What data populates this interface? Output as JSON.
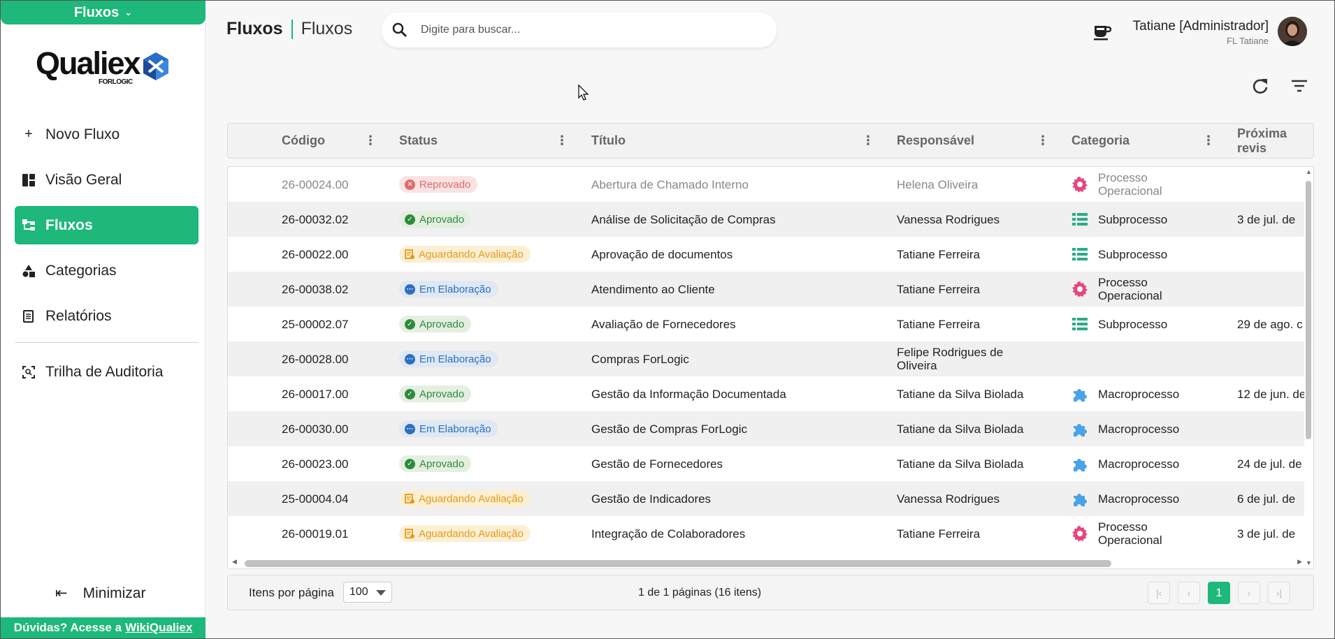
{
  "app_switcher": {
    "label": "Fluxos"
  },
  "logo": {
    "text": "Qualiex",
    "sub": "FORLOGIC"
  },
  "sidebar": {
    "items": [
      {
        "label": "Novo Fluxo",
        "icon": "plus-icon"
      },
      {
        "label": "Visão Geral",
        "icon": "dashboard-icon"
      },
      {
        "label": "Fluxos",
        "icon": "flow-icon",
        "active": true
      },
      {
        "label": "Categorias",
        "icon": "shapes-icon"
      },
      {
        "label": "Relatórios",
        "icon": "report-icon"
      },
      {
        "label": "Trilha de Auditoria",
        "icon": "audit-icon"
      }
    ],
    "minimize_label": "Minimizar",
    "help_text": "Dúvidas? Acesse a",
    "help_link": "WikiQualiex"
  },
  "header": {
    "title_main": "Fluxos",
    "title_sub": "Fluxos",
    "search_placeholder": "Digite para buscar...",
    "user_name": "Tatiane [Administrador]",
    "user_company": "FL Tatiane"
  },
  "table": {
    "columns": [
      "Código",
      "Status",
      "Título",
      "Responsável",
      "Categoria",
      "Próxima revis"
    ],
    "rows": [
      {
        "code": "26-00024.00",
        "status": "Reprovado",
        "status_type": "red",
        "title": "Abertura de Chamado Interno",
        "owner": "Helena Oliveira",
        "category": "Processo Operacional",
        "category_icon": "gear",
        "next": "",
        "dim": true
      },
      {
        "code": "26-00032.02",
        "status": "Aprovado",
        "status_type": "green",
        "title": "Análise de Solicitação de Compras",
        "owner": "Vanessa Rodrigues",
        "category": "Subprocesso",
        "category_icon": "list",
        "next": "3 de jul. de"
      },
      {
        "code": "26-00022.00",
        "status": "Aguardando Avaliação",
        "status_type": "yellow",
        "title": "Aprovação de documentos",
        "owner": "Tatiane Ferreira",
        "category": "Subprocesso",
        "category_icon": "list",
        "next": ""
      },
      {
        "code": "26-00038.02",
        "status": "Em Elaboração",
        "status_type": "blue",
        "title": "Atendimento ao Cliente",
        "owner": "Tatiane Ferreira",
        "category": "Processo Operacional",
        "category_icon": "gear",
        "next": ""
      },
      {
        "code": "25-00002.07",
        "status": "Aprovado",
        "status_type": "green",
        "title": "Avaliação de Fornecedores",
        "owner": "Tatiane Ferreira",
        "category": "Subprocesso",
        "category_icon": "list",
        "next": "29 de ago. c"
      },
      {
        "code": "26-00028.00",
        "status": "Em Elaboração",
        "status_type": "blue",
        "title": "Compras ForLogic",
        "owner": "Felipe Rodrigues de Oliveira",
        "category": "",
        "category_icon": "",
        "next": ""
      },
      {
        "code": "26-00017.00",
        "status": "Aprovado",
        "status_type": "green",
        "title": "Gestão da Informação Documentada",
        "owner": "Tatiane da Silva Biolada",
        "category": "Macroprocesso",
        "category_icon": "puzzle",
        "next": "12 de jun. de"
      },
      {
        "code": "26-00030.00",
        "status": "Em Elaboração",
        "status_type": "blue",
        "title": "Gestão de Compras ForLogic",
        "owner": "Tatiane da Silva Biolada",
        "category": "Macroprocesso",
        "category_icon": "puzzle",
        "next": ""
      },
      {
        "code": "26-00023.00",
        "status": "Aprovado",
        "status_type": "green",
        "title": "Gestão de Fornecedores",
        "owner": "Tatiane da Silva Biolada",
        "category": "Macroprocesso",
        "category_icon": "puzzle",
        "next": "24 de jul. de"
      },
      {
        "code": "25-00004.04",
        "status": "Aguardando Avaliação",
        "status_type": "yellow",
        "title": "Gestão de Indicadores",
        "owner": "Vanessa Rodrigues",
        "category": "Macroprocesso",
        "category_icon": "puzzle",
        "next": "6 de jul. de"
      },
      {
        "code": "26-00019.01",
        "status": "Aguardando Avaliação",
        "status_type": "yellow",
        "title": "Integração de Colaboradores",
        "owner": "Tatiane Ferreira",
        "category": "Processo Operacional",
        "category_icon": "gear",
        "next": "3 de jul. de"
      }
    ]
  },
  "pagination": {
    "items_per_page_label": "Itens por página",
    "items_per_page_value": "100",
    "info": "1 de 1 páginas (16 itens)",
    "current_page": "1"
  },
  "colors": {
    "accent": "#1db87a",
    "approved": "#2e8b3d",
    "rejected": "#e06a6a",
    "pending": "#e59a18",
    "draft": "#2c6fbf",
    "gear_icon": "#e8457a",
    "list_icon": "#2bab86",
    "puzzle_icon": "#4aa3e8"
  }
}
